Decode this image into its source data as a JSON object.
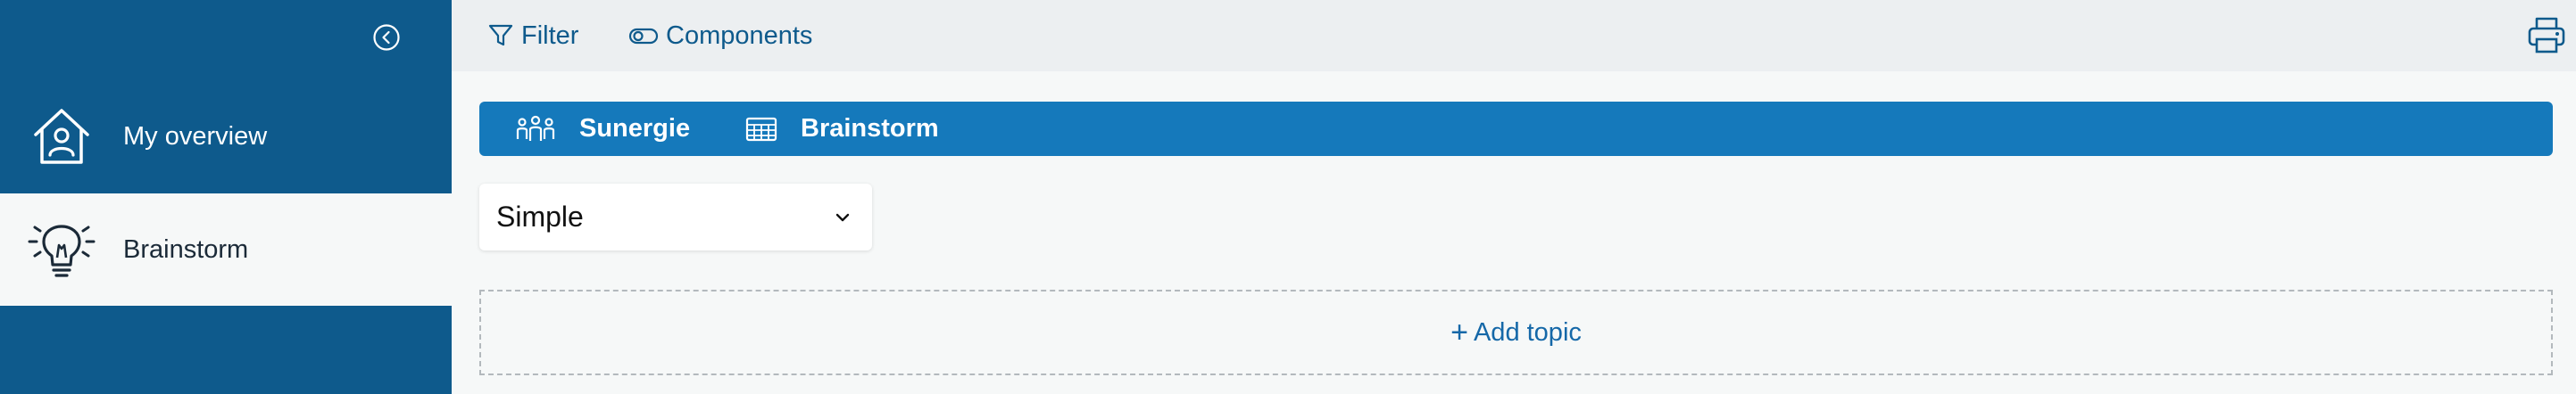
{
  "sidebar": {
    "collapse_icon": "chevron-left-circle-icon",
    "items": [
      {
        "label": "My overview",
        "icon": "home-user-icon",
        "active": false
      },
      {
        "label": "Brainstorm",
        "icon": "lightbulb-icon",
        "active": true
      }
    ]
  },
  "toolbar": {
    "filter_label": "Filter",
    "components_label": "Components",
    "print_icon": "printer-icon"
  },
  "banner": {
    "group_label": "Sunergie",
    "board_label": "Brainstorm"
  },
  "view_select": {
    "selected": "Simple"
  },
  "add_topic_label": "Add topic",
  "colors": {
    "sidebar_bg": "#0e5a8c",
    "banner_bg": "#1579bb",
    "accent_text": "#1568a8",
    "page_bg": "#f6f8f8"
  }
}
